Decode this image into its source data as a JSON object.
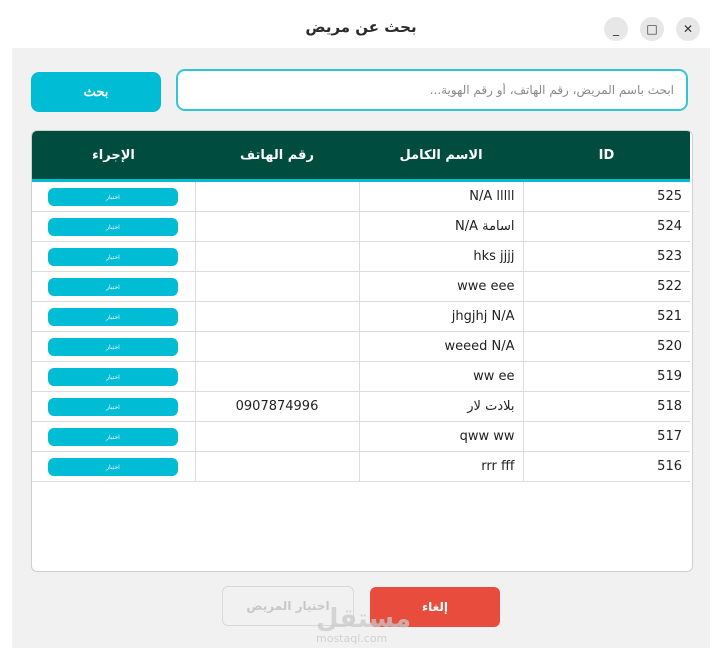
{
  "window": {
    "title": "بحث عن مريض",
    "minimize_glyph": "_",
    "maximize_glyph": "□",
    "close_glyph": "✕"
  },
  "search": {
    "button_label": "بحث",
    "placeholder": "ابحث باسم المريض، رقم الهاتف، أو رقم الهوية...",
    "value": ""
  },
  "table": {
    "headers": {
      "action": "الإجراء",
      "phone": "رقم الهاتف",
      "name": "الاسم الكامل",
      "id": "ID"
    },
    "rows": [
      {
        "id": "525",
        "name": "N/A lllll",
        "phone": "",
        "action": "اختيار"
      },
      {
        "id": "524",
        "name": "اسامة N/A",
        "phone": "",
        "action": "اختيار"
      },
      {
        "id": "523",
        "name": "hks jjjj",
        "phone": "",
        "action": "اختيار"
      },
      {
        "id": "522",
        "name": "wwe eee",
        "phone": "",
        "action": "اختيار"
      },
      {
        "id": "521",
        "name": "jhgjhj N/A",
        "phone": "",
        "action": "اختيار"
      },
      {
        "id": "520",
        "name": "weeed N/A",
        "phone": "",
        "action": "اختيار"
      },
      {
        "id": "519",
        "name": "ww ee",
        "phone": "",
        "action": "اختيار"
      },
      {
        "id": "518",
        "name": "بلادت لار",
        "phone": "0907874996",
        "action": "اختيار"
      },
      {
        "id": "517",
        "name": "qww ww",
        "phone": "",
        "action": "اختيار"
      },
      {
        "id": "516",
        "name": "rrr fff",
        "phone": "",
        "action": "اختيار"
      }
    ]
  },
  "footer": {
    "cancel_label": "إلغاء",
    "choose_label": "اختيار المريض"
  },
  "watermark": {
    "text": "مستقل",
    "subtext": "mostaql.com"
  },
  "colors": {
    "header_bg": "#004d40",
    "accent": "#00bcd4",
    "cancel": "#e84c3d"
  }
}
